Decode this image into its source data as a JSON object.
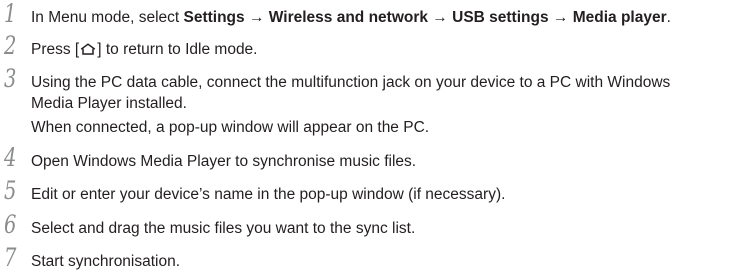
{
  "steps": [
    {
      "number": "1",
      "parts": {
        "a": "In Menu mode, select ",
        "b": "Settings",
        "c": " → ",
        "d": "Wireless and network",
        "e": " → ",
        "f": "USB settings",
        "g": " → ",
        "h": "Media player",
        "i": "."
      }
    },
    {
      "number": "2",
      "before": "Press [",
      "icon": "home-icon",
      "after": "] to return to Idle mode."
    },
    {
      "number": "3",
      "line1": "Using the PC data cable, connect the multifunction jack on your device to a PC with Windows",
      "line2": "Media Player installed.",
      "sub": "When connected, a pop-up window will appear on the PC."
    },
    {
      "number": "4",
      "text": "Open Windows Media Player to synchronise music files."
    },
    {
      "number": "5",
      "text": "Edit or enter your device’s name in the pop-up window (if necessary)."
    },
    {
      "number": "6",
      "text": "Select and drag the music files you want to the sync list."
    },
    {
      "number": "7",
      "text": "Start synchronisation."
    }
  ]
}
